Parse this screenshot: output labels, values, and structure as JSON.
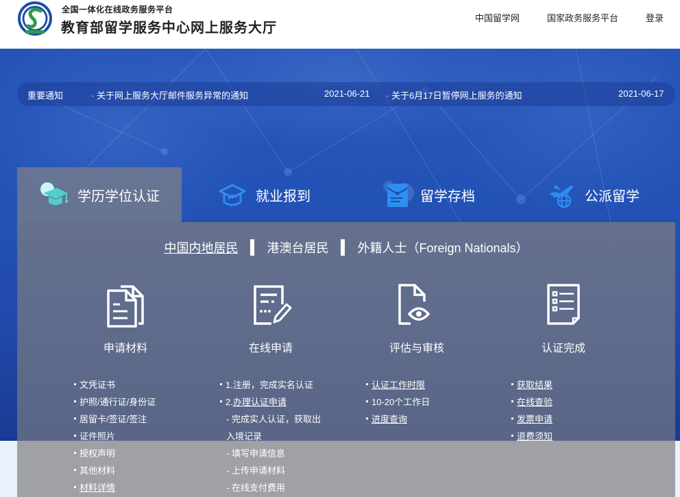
{
  "header": {
    "platform": "全国一体化在线政务服务平台",
    "title": "教育部留学服务中心网上服务大厅",
    "nav": [
      "中国留学网",
      "国家政务服务平台",
      "登录"
    ]
  },
  "notice": {
    "label": "重要通知",
    "items": [
      {
        "title": "关于网上服务大厅邮件服务异常的通知",
        "date": "2021-06-21"
      },
      {
        "title": "关于6月17日暂停网上服务的通知",
        "date": "2021-06-17"
      }
    ]
  },
  "tabs": [
    {
      "label": "学历学位认证",
      "icon": "graduation-cap-icon",
      "active": true
    },
    {
      "label": "就业报到",
      "icon": "mortarboard-outline-icon",
      "active": false
    },
    {
      "label": "留学存档",
      "icon": "archive-envelope-icon",
      "active": false
    },
    {
      "label": "公派留学",
      "icon": "plane-globe-icon",
      "active": false
    }
  ],
  "residency": {
    "options": [
      "中国内地居民",
      "港澳台居民",
      "外籍人士（Foreign Nationals）"
    ],
    "selected": 0
  },
  "steps": [
    {
      "title": "申请材料",
      "icon": "documents-icon"
    },
    {
      "title": "在线申请",
      "icon": "form-edit-icon"
    },
    {
      "title": "评估与审核",
      "icon": "document-eye-icon"
    },
    {
      "title": "认证完成",
      "icon": "checklist-icon"
    }
  ],
  "columns": [
    [
      {
        "text": "文凭证书",
        "bullet": true,
        "link": false
      },
      {
        "text": "护照/通行证/身份证",
        "bullet": true,
        "link": false
      },
      {
        "text": "居留卡/签证/签注",
        "bullet": true,
        "link": false
      },
      {
        "text": "证件照片",
        "bullet": true,
        "link": false
      },
      {
        "text": "授权声明",
        "bullet": true,
        "link": false
      },
      {
        "text": "其他材料",
        "bullet": true,
        "link": false
      },
      {
        "text": "材料详情",
        "bullet": true,
        "link": true
      }
    ],
    [
      {
        "text": "1.注册，完成实名认证",
        "bullet": true,
        "link": false
      },
      {
        "prefix": "2.",
        "text": "办理认证申请",
        "bullet": true,
        "link": true
      },
      {
        "text": "- 完成实人认证，获取出",
        "bullet": false,
        "link": false
      },
      {
        "text": "入境记录",
        "bullet": false,
        "link": false
      },
      {
        "text": "- 填写申请信息",
        "bullet": false,
        "link": false
      },
      {
        "text": "- 上传申请材料",
        "bullet": false,
        "link": false
      },
      {
        "text": "- 在线支付费用",
        "bullet": false,
        "link": false
      }
    ],
    [
      {
        "text": "认证工作时限",
        "bullet": true,
        "link": true
      },
      {
        "text": "10-20个工作日",
        "bullet": true,
        "link": false
      },
      {
        "text": "进度查询",
        "bullet": true,
        "link": true
      }
    ],
    [
      {
        "text": "获取结果",
        "bullet": true,
        "link": true
      },
      {
        "text": "在线查验",
        "bullet": true,
        "link": true
      },
      {
        "text": "发票申请",
        "bullet": true,
        "link": true
      },
      {
        "text": "退费须知",
        "bullet": true,
        "link": true
      }
    ]
  ],
  "colors": {
    "banner": "#2352b6",
    "tab_icon": "#2f8df0",
    "active_tab_icon": "#4fd1c9",
    "panel": "#68728c",
    "panel_lower": "#a0a1a6"
  }
}
